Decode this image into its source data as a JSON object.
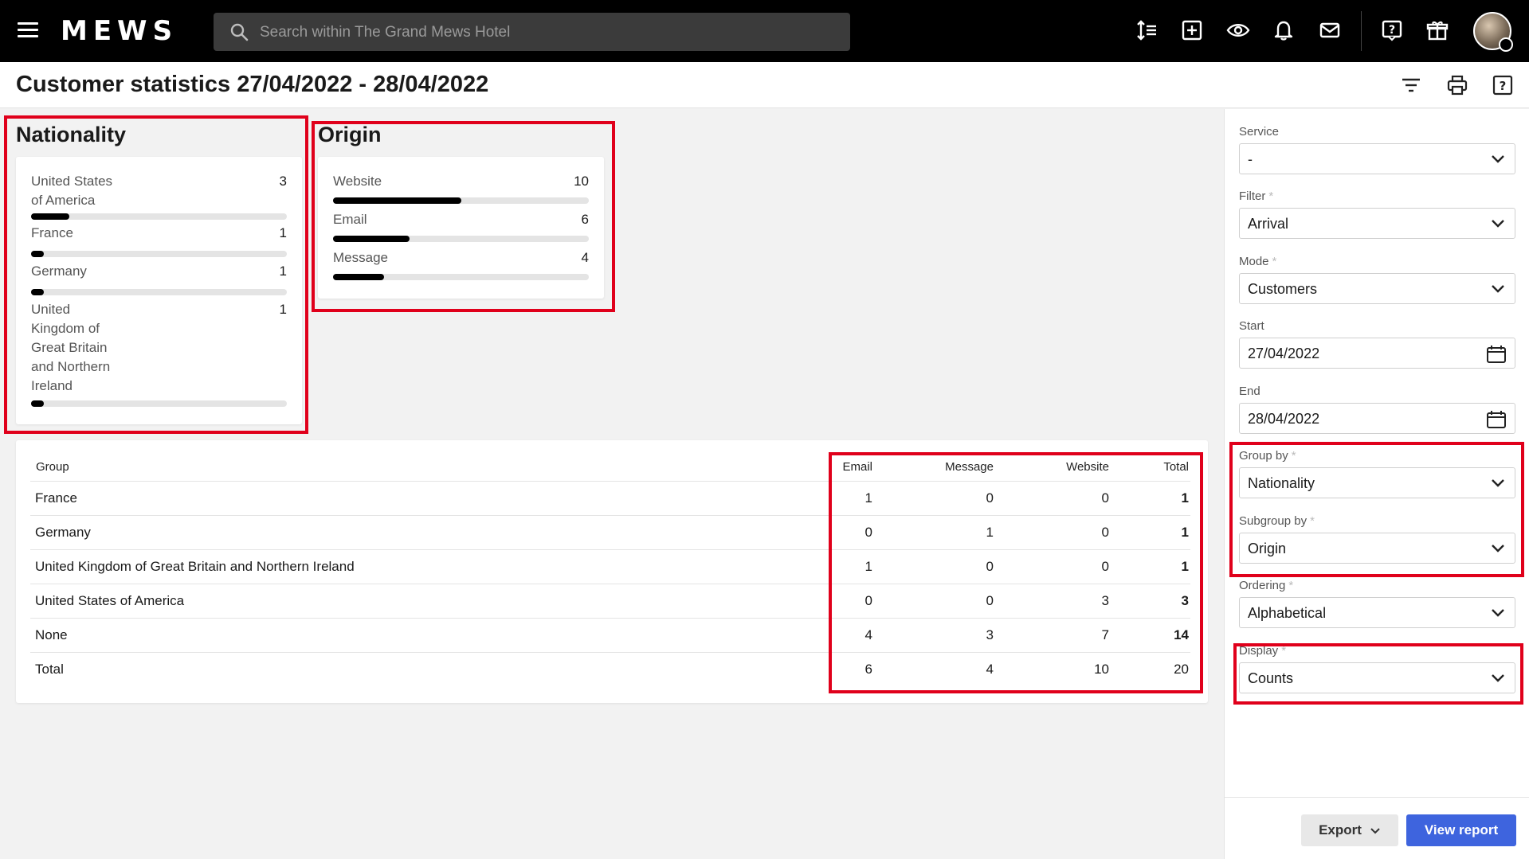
{
  "header": {
    "logo": "MEWS",
    "search_placeholder": "Search within The Grand Mews Hotel",
    "icons": [
      "sort-icon",
      "add-box-icon",
      "eye-icon",
      "bell-icon",
      "mail-icon",
      "help-icon",
      "gift-icon"
    ]
  },
  "page": {
    "title": "Customer statistics 27/04/2022 - 28/04/2022"
  },
  "nationality": {
    "title": "Nationality",
    "items": [
      {
        "label_lines": [
          "United States",
          "of America"
        ],
        "value": "3",
        "fraction": 0.15
      },
      {
        "label_lines": [
          "France"
        ],
        "value": "1",
        "fraction": 0.05
      },
      {
        "label_lines": [
          "Germany"
        ],
        "value": "1",
        "fraction": 0.05
      },
      {
        "label_lines": [
          "United",
          "Kingdom of",
          "Great Britain",
          "and Northern",
          "Ireland"
        ],
        "value": "1",
        "fraction": 0.05
      }
    ]
  },
  "origin": {
    "title": "Origin",
    "items": [
      {
        "label": "Website",
        "value": "10",
        "fraction": 0.5
      },
      {
        "label": "Email",
        "value": "6",
        "fraction": 0.3
      },
      {
        "label": "Message",
        "value": "4",
        "fraction": 0.2
      }
    ]
  },
  "table": {
    "headers": {
      "group": "Group",
      "email": "Email",
      "message": "Message",
      "website": "Website",
      "total": "Total"
    },
    "rows": [
      {
        "group": "France",
        "email": "1",
        "message": "0",
        "website": "0",
        "total": "1"
      },
      {
        "group": "Germany",
        "email": "0",
        "message": "1",
        "website": "0",
        "total": "1"
      },
      {
        "group": "United Kingdom of Great Britain and Northern Ireland",
        "email": "1",
        "message": "0",
        "website": "0",
        "total": "1"
      },
      {
        "group": "United States of America",
        "email": "0",
        "message": "0",
        "website": "3",
        "total": "3"
      },
      {
        "group": "None",
        "email": "4",
        "message": "3",
        "website": "7",
        "total": "14"
      },
      {
        "group": "Total",
        "email": "6",
        "message": "4",
        "website": "10",
        "total": "20"
      }
    ]
  },
  "sidebar": {
    "fields": [
      {
        "label": "Service",
        "required": false,
        "value": "-",
        "icon": "chevron-down-icon"
      },
      {
        "label": "Filter",
        "required": true,
        "value": "Arrival",
        "icon": "chevron-down-icon"
      },
      {
        "label": "Mode",
        "required": true,
        "value": "Customers",
        "icon": "chevron-down-icon"
      },
      {
        "label": "Start",
        "required": false,
        "value": "27/04/2022",
        "icon": "calendar-icon"
      },
      {
        "label": "End",
        "required": false,
        "value": "28/04/2022",
        "icon": "calendar-icon"
      },
      {
        "label": "Group by",
        "required": true,
        "value": "Nationality",
        "icon": "chevron-down-icon"
      },
      {
        "label": "Subgroup by",
        "required": true,
        "value": "Origin",
        "icon": "chevron-down-icon"
      },
      {
        "label": "Ordering",
        "required": true,
        "value": "Alphabetical",
        "icon": "chevron-down-icon"
      },
      {
        "label": "Display",
        "required": true,
        "value": "Counts",
        "icon": "chevron-down-icon"
      }
    ],
    "required_mark": "*",
    "export_label": "Export",
    "view_report_label": "View report"
  },
  "colors": {
    "highlight": "#e0001b",
    "primary_button": "#3e64de",
    "bar_fill": "#000000"
  }
}
